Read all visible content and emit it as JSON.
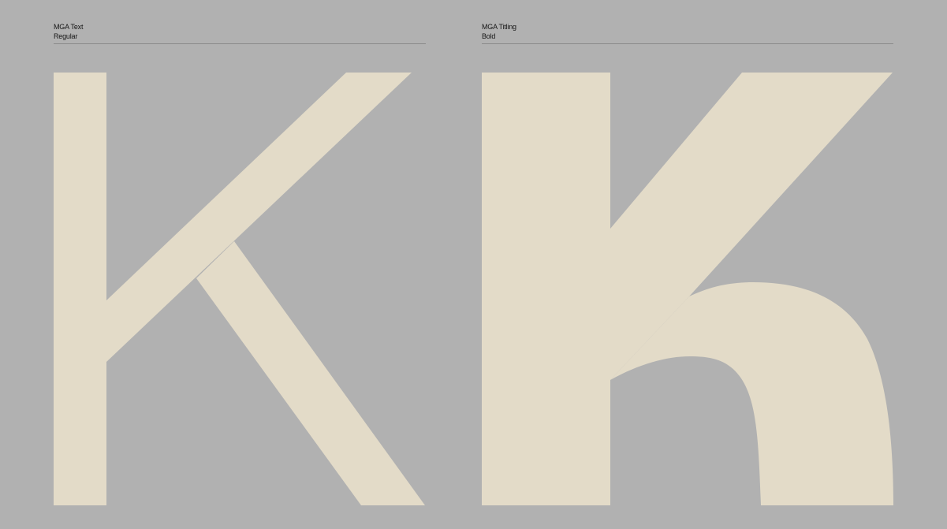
{
  "colors": {
    "background": "#b1b1b1",
    "glyph_fill": "#e3dbc8",
    "rule": "#8a8a8a",
    "label_text": "#161616"
  },
  "specimens": [
    {
      "family": "MGA Text",
      "style": "Regular",
      "glyph": "K"
    },
    {
      "family": "MGA Titling",
      "style": "Bold",
      "glyph": "K"
    }
  ]
}
